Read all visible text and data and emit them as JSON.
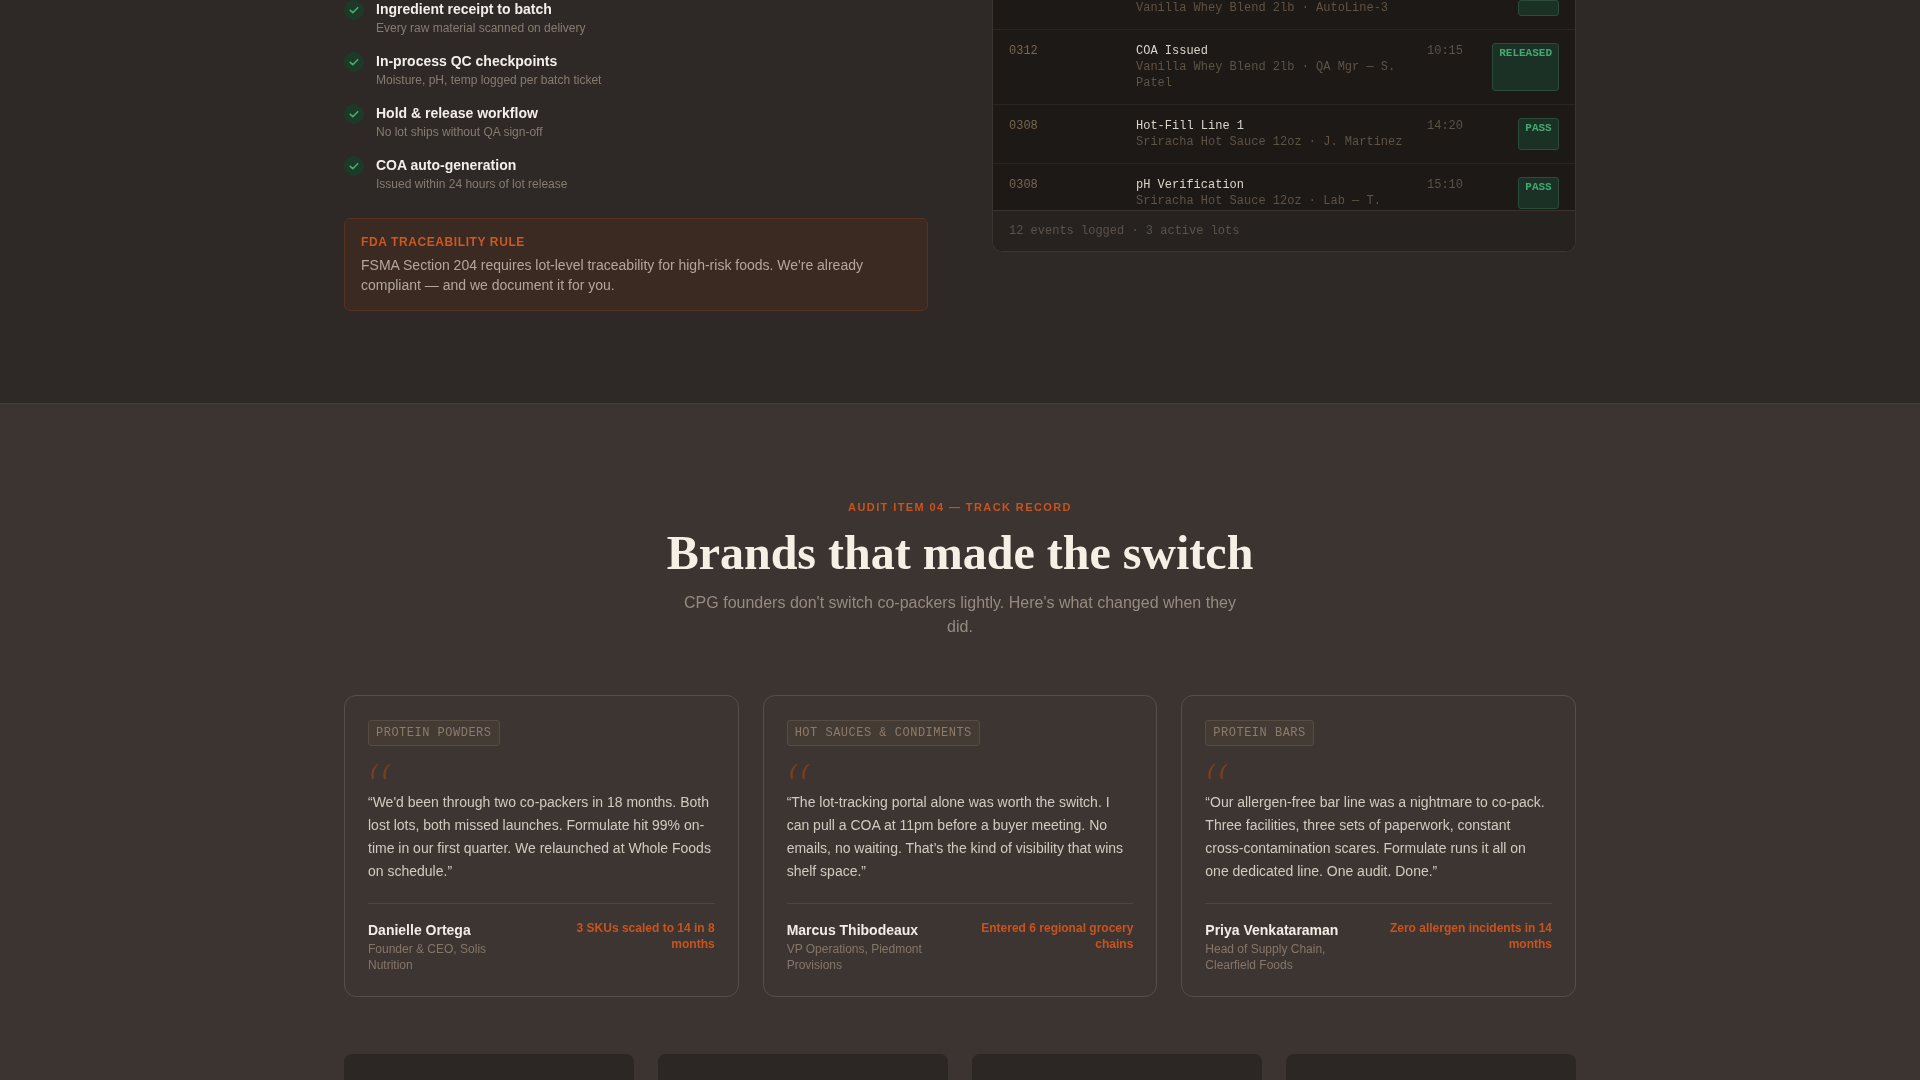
{
  "checklist": [
    {
      "title": "Ingredient receipt to batch",
      "detail": "Every raw material scanned on delivery",
      "checked": true
    },
    {
      "title": "In-process QC checkpoints",
      "detail": "Moisture, pH, temp logged per batch ticket",
      "checked": true
    },
    {
      "title": "Hold & release workflow",
      "detail": "No lot ships without QA sign-off",
      "checked": true
    },
    {
      "title": "COA auto-generation",
      "detail": "Issued within 24 hours of lot release",
      "checked": true
    }
  ],
  "callout": {
    "label": "FDA TRACEABILITY RULE",
    "text": "FSMA Section 204 requires lot-level traceability for high-risk foods. We're already compliant — and we document it for you."
  },
  "event_log": {
    "rows": [
      {
        "kind": "partial",
        "detail": "Vanilla Whey Blend 2lb · AutoLine-3"
      },
      {
        "kind": "event",
        "lot": "0312",
        "event": "COA Issued",
        "detail": "Vanilla Whey Blend 2lb · QA Mgr — S. Patel",
        "time": "10:15",
        "status": "RELEASED"
      },
      {
        "kind": "event",
        "lot": "0308",
        "event": "Hot-Fill Line 1",
        "detail": "Sriracha Hot Sauce 12oz · J. Martinez",
        "time": "14:20",
        "status": "PASS"
      },
      {
        "kind": "event",
        "lot": "0308",
        "event": "pH Verification",
        "detail": "Sriracha Hot Sauce 12oz · Lab — T.",
        "time": "15:10",
        "status": "PASS"
      }
    ],
    "footer": "12 events logged · 3 active lots"
  },
  "testimonials": {
    "eyebrow": "AUDIT ITEM 04 — TRACK RECORD",
    "heading": "Brands that made the switch",
    "subheading": "CPG founders don't switch co-packers lightly. Here's what changed when they did.",
    "cards": [
      {
        "category": "PROTEIN POWDERS",
        "quote": "“We'd been through two co-packers in 18 months. Both lost lots, both missed launches. Formulate hit 99% on-time in our first quarter. We relaunched at Whole Foods on schedule.”",
        "name": "Danielle Ortega",
        "role": "Founder & CEO, Solis Nutrition",
        "result": "3 SKUs scaled to 14 in 8 months"
      },
      {
        "category": "HOT SAUCES & CONDIMENTS",
        "quote": "“The lot-tracking portal alone was worth the switch. I can pull a COA at 11pm before a buyer meeting. No emails, no waiting. That’s the kind of visibility that wins shelf space.”",
        "name": "Marcus Thibodeaux",
        "role": "VP Operations, Piedmont Provisions",
        "result": "Entered 6 regional grocery chains"
      },
      {
        "category": "PROTEIN BARS",
        "quote": "“Our allergen-free bar line was a nightmare to co-pack. Three facilities, three sets of paperwork, constant cross-contamination scares. Formulate runs it all on one dedicated line. One audit. Done.”",
        "name": "Priya Venkataraman",
        "role": "Head of Supply Chain, Clearfield Foods",
        "result": "Zero allergen incidents in 14 months"
      }
    ]
  }
}
